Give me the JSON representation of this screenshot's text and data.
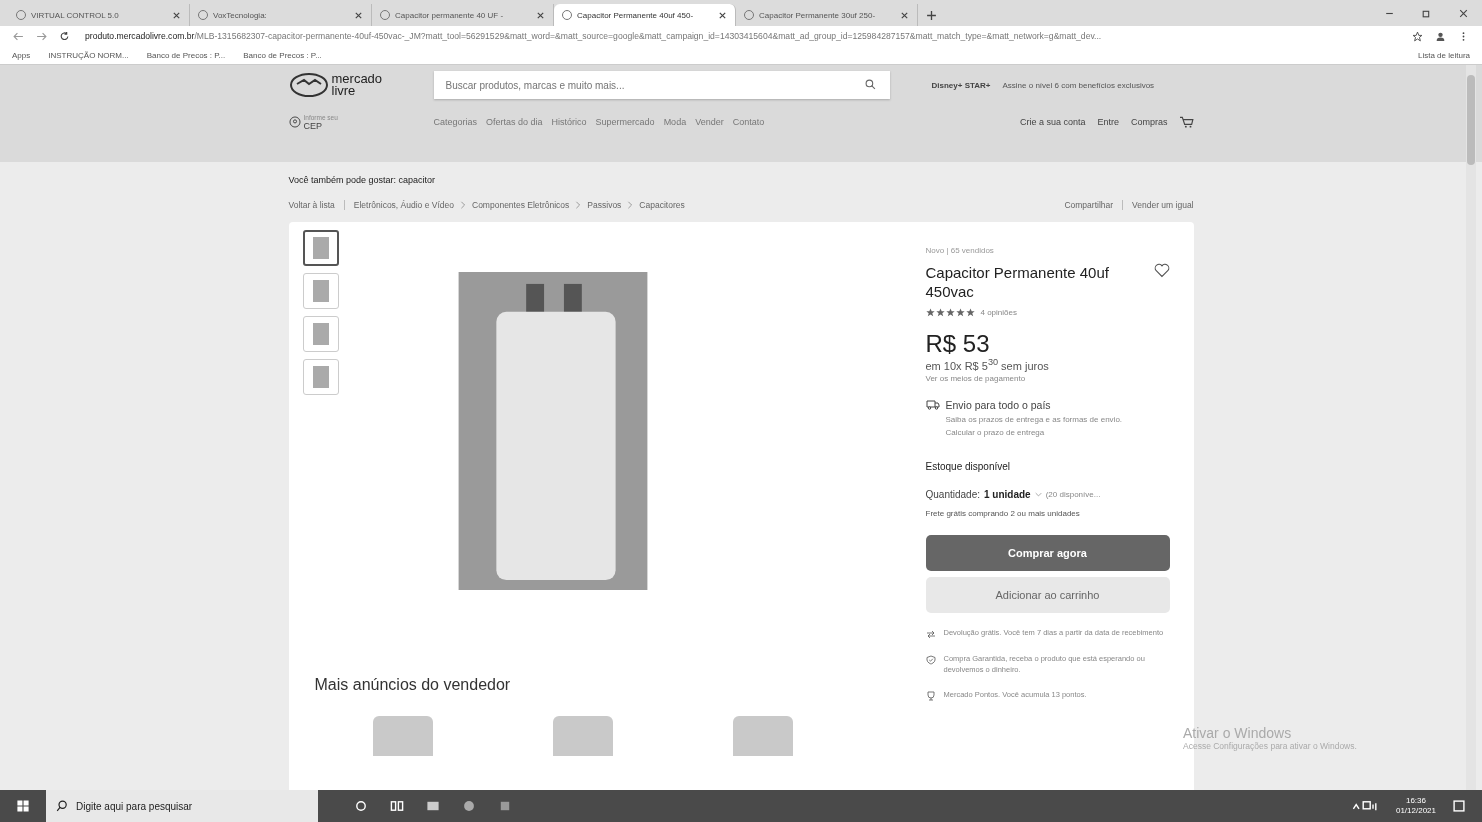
{
  "browser": {
    "tabs": [
      {
        "title": "VIRTUAL CONTROL 5.0",
        "selected": false
      },
      {
        "title": "VoxTecnologia:",
        "selected": false
      },
      {
        "title": "Capacitor permanente 40 UF - ",
        "selected": false
      },
      {
        "title": "Capacitor Permanente 40uf 450-",
        "selected": true
      },
      {
        "title": "Capacitor Permanente 30uf 250-",
        "selected": false
      }
    ],
    "url_host": "produto.mercadolivre.com.br",
    "url_path": "/MLB-1315682307-capacitor-permanente-40uf-450vac-_JM?matt_tool=56291529&matt_word=&matt_source=google&matt_campaign_id=14303415604&matt_ad_group_id=125984287157&matt_match_type=&matt_network=g&matt_dev...",
    "bookmarks": [
      "Apps",
      "INSTRUÇÃO NORM...",
      "Banco de Precos : P...",
      "Banco de Precos : P..."
    ],
    "reading_list": "Lista de leitura"
  },
  "header": {
    "logo": [
      "mercado",
      "livre"
    ],
    "search_placeholder": "Buscar produtos, marcas e muito mais...",
    "promo_logo": "Disney+ STAR+",
    "promo_text": "Assine o nível 6 com benefícios exclusivos",
    "location": [
      "Informe seu",
      "CEP"
    ],
    "nav": [
      "Categorias",
      "Ofertas do dia",
      "Histórico",
      "Supermercado",
      "Moda",
      "Vender",
      "Contato"
    ],
    "account": [
      "Crie a sua conta",
      "Entre",
      "Compras"
    ]
  },
  "suggestion": "Você também pode gostar: capacitor",
  "breadcrumb": {
    "back": "Voltar à lista",
    "path": [
      "Eletrônicos, Áudio e Vídeo",
      "Componentes Eletrônicos",
      "Passivos",
      "Capacitores"
    ],
    "actions": [
      "Compartilhar",
      "Vender um igual"
    ]
  },
  "product": {
    "thumbnails": [
      {
        "selected": true
      },
      {
        "selected": false
      },
      {
        "selected": false
      },
      {
        "selected": false
      }
    ],
    "condition": "Novo  |  65 vendidos",
    "title": "Capacitor Permanente 40uf 450vac",
    "stars": 5,
    "reviews": "4 opiniões",
    "price": "R$ 53",
    "installments": "em 10x R$ 5$^{30}$ sem juros",
    "payment_link": "Ver os meios de pagamento",
    "shipping": {
      "title": "Envio para todo o país",
      "text": "Saiba os prazos de entrega e as formas de envio.",
      "link": "Calcular o prazo de entrega"
    },
    "stock": "Estoque disponível",
    "quantity_label": "Quantidade:",
    "quantity": "1 unidade",
    "available": "(20 disponíve...",
    "free_shipping": "Frete grátis comprando 2 ou mais unidades",
    "buy": "Comprar agora",
    "cart": "Adicionar ao carrinho",
    "benefits": [
      {
        "kind": "return",
        "text": "Devolução grátis. Você tem 7 dias a partir da data de recebimento"
      },
      {
        "kind": "shield",
        "text": "Compra Garantida, receba o produto que está esperando ou devolvemos o dinheiro."
      },
      {
        "kind": "points",
        "text": "Mercado Pontos. Você acumula 13 pontos."
      }
    ]
  },
  "more_title": "Mais anúncios do vendedor",
  "activation": {
    "title": "Ativar o Windows",
    "text": "Acesse Configurações para ativar o Windows."
  },
  "taskbar": {
    "search_placeholder": "Digite aqui para pesquisar",
    "time": "16:36",
    "date": "01/12/2021"
  }
}
